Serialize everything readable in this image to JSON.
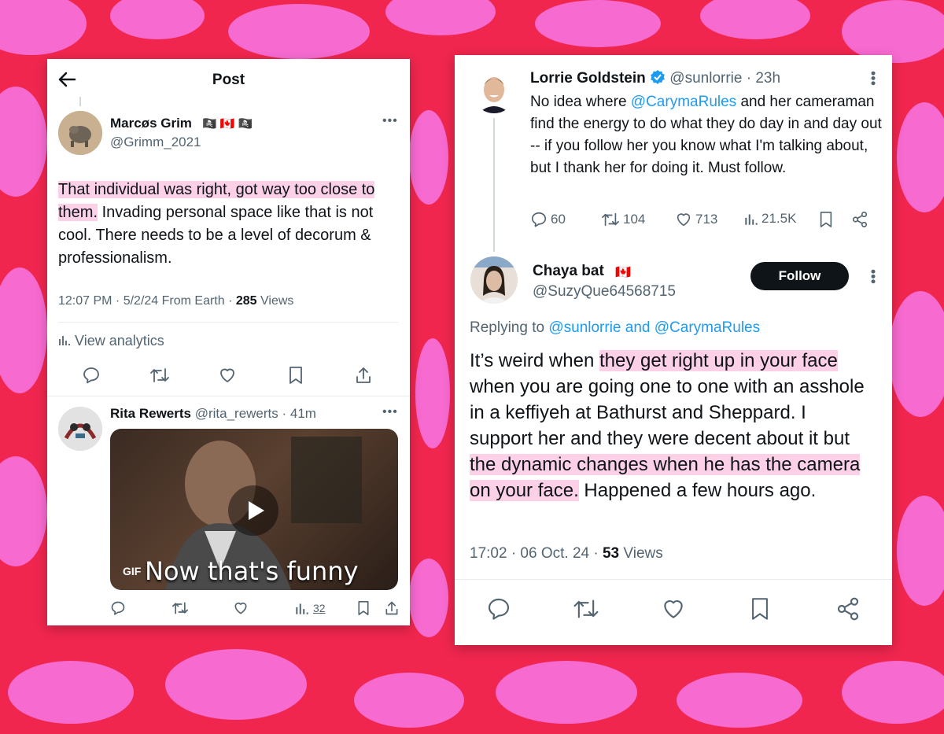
{
  "left_post": {
    "header_title": "Post",
    "author": {
      "name": "Marcøs Grim",
      "flags": "🏴‍☠️ 🇨🇦 🏴‍☠️",
      "handle": "@Grimm_2021"
    },
    "body_highlight": "That individual was right, got way too close to them.",
    "body_rest": " Invading personal space like that is not cool. There needs to be a level of decorum & professionalism.",
    "meta": {
      "time": "12:07 PM · 5/2/24 From Earth · ",
      "views_count": "285",
      "views_label": " Views"
    },
    "analytics_label": "View analytics",
    "actions": [
      "reply-icon",
      "retweet-icon",
      "like-icon",
      "bookmark-icon",
      "share-icon"
    ],
    "reply": {
      "name": "Rita Rewerts",
      "handle": " @rita_rewerts · 41m",
      "gif_badge": "GIF",
      "gif_caption": "Now that's funny",
      "views": "32"
    }
  },
  "right_post": {
    "tweet1": {
      "name": "Lorrie Goldstein",
      "handle": " @sunlorrie · 23h",
      "text_before": "No idea where ",
      "mention": "@CarymaRules",
      "text_after": " and her cameraman find the energy to do what they do day in and day out -- if you follow her you know what I'm talking about, but I thank her for doing it. Must follow.",
      "stats": {
        "replies": "60",
        "reposts": "104",
        "likes": "713",
        "views": "21.5K"
      }
    },
    "tweet2": {
      "name": "Chaya bat",
      "flag": "🇨🇦",
      "handle": "@SuzyQue64568715",
      "follow_label": "Follow",
      "replying_prefix": "Replying to ",
      "replying_to": "@sunlorrie and @CarymaRules",
      "body": {
        "p1": "It’s weird when ",
        "h1": "they get right up in your face",
        "p2": " when you are going one to one with an asshole in a keffiyeh at Bathurst and Sheppard. I support her and they were decent about it but ",
        "h2": "the dynamic changes when he has the camera on your face.",
        "p3": " Happened a few hours ago."
      },
      "meta": {
        "time": "17:02 · 06 Oct. 24 · ",
        "views_count": "53",
        "views_label": " Views"
      }
    }
  },
  "colors": {
    "background": "#f0264e",
    "background_spots": "#f76ad0",
    "highlight": "#fcd1e7",
    "link": "#1d9bf0"
  }
}
